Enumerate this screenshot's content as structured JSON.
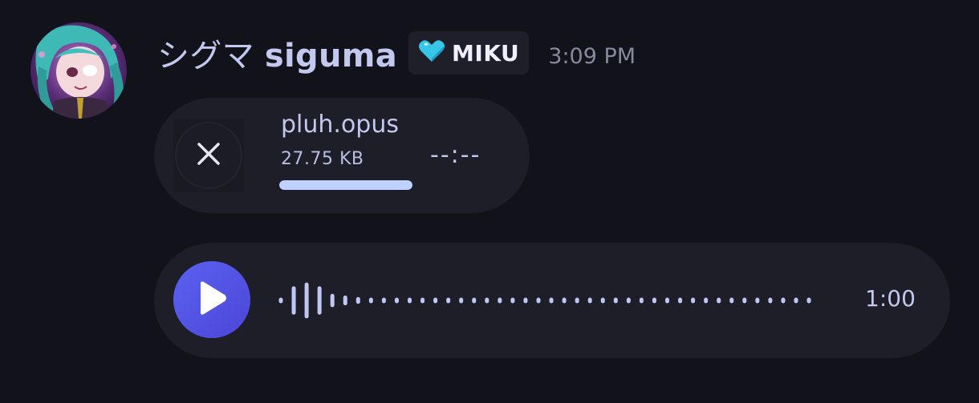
{
  "user": {
    "display_name_jp": "シグマ",
    "display_name": "siguma"
  },
  "badge": {
    "icon": "heart-icon",
    "label": "MIKU",
    "color": "#37c6e8"
  },
  "timestamp": "3:09 PM",
  "file_attachment": {
    "name": "pluh.opus",
    "size": "27.75 KB",
    "duration": "--:--",
    "upload_progress": 1.0,
    "cancel_icon": "close-icon"
  },
  "voice_message": {
    "play_icon": "play-icon",
    "duration": "1:00",
    "accent": "#5458e8",
    "waveform_levels": [
      0.08,
      0.55,
      0.7,
      0.55,
      0.25,
      0.18,
      0.12,
      0.08,
      0.08,
      0.08,
      0.08,
      0.08,
      0.08,
      0.08,
      0.08,
      0.08,
      0.08,
      0.08,
      0.08,
      0.08,
      0.08,
      0.08,
      0.08,
      0.08,
      0.08,
      0.08,
      0.08,
      0.08,
      0.08,
      0.08,
      0.08,
      0.08,
      0.08,
      0.08,
      0.08,
      0.08,
      0.08,
      0.08,
      0.08,
      0.08,
      0.08,
      0.08
    ]
  }
}
